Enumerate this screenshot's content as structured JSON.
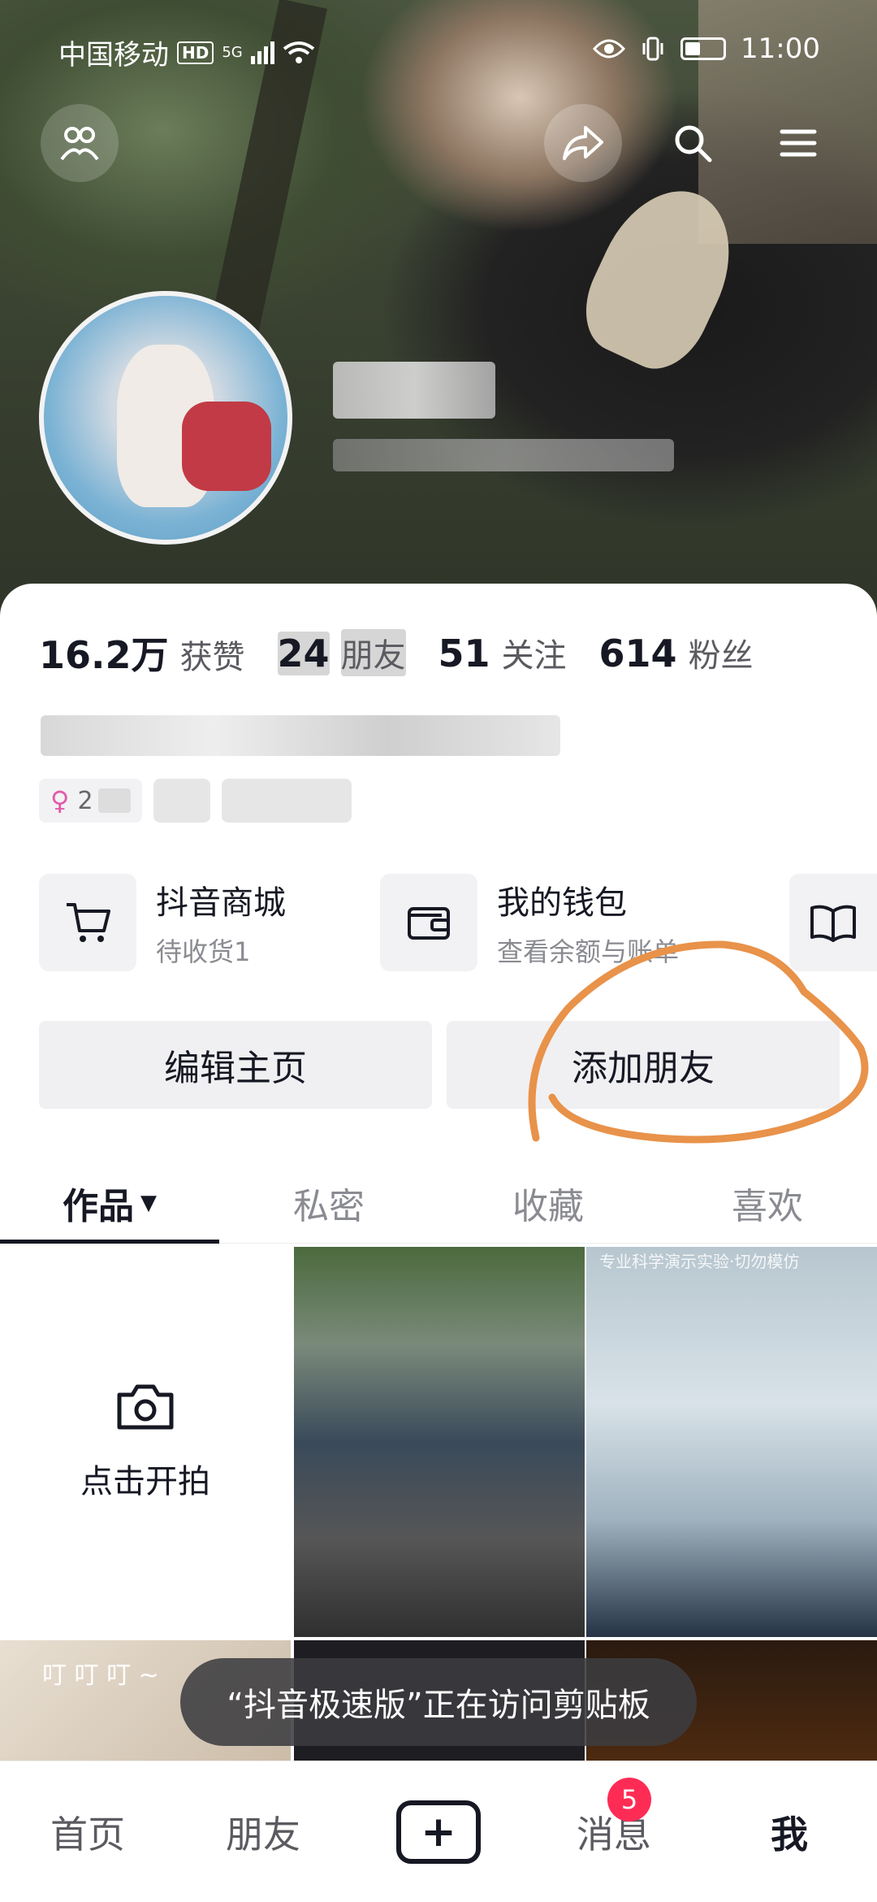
{
  "status_bar": {
    "carrier": "中国移动",
    "hd": "HD",
    "network": "5G",
    "time": "11:00"
  },
  "profile": {
    "stats": [
      {
        "value": "16.2万",
        "label": "获赞"
      },
      {
        "value": "24",
        "label": "朋友"
      },
      {
        "value": "51",
        "label": "关注"
      },
      {
        "value": "614",
        "label": "粉丝"
      }
    ],
    "tag_age": "2"
  },
  "shortcuts": [
    {
      "title": "抖音商城",
      "subtitle": "待收货1",
      "icon": "cart-icon"
    },
    {
      "title": "我的钱包",
      "subtitle": "查看余额与账单",
      "icon": "wallet-icon"
    },
    {
      "title": "",
      "subtitle": "",
      "icon": "book-icon"
    }
  ],
  "actions": {
    "edit_profile": "编辑主页",
    "add_friend": "添加朋友"
  },
  "tabs": [
    "作品",
    "私密",
    "收藏",
    "喜欢"
  ],
  "grid": {
    "shoot_label": "点击开拍",
    "video2_watermark": "专业科学演示实验·切勿模仿",
    "video3_caption": "叮 叮 叮 ~"
  },
  "toast": "“抖音极速版”正在访问剪贴板",
  "bottom_nav": {
    "home": "首页",
    "friends": "朋友",
    "messages": "消息",
    "messages_badge": "5",
    "me": "我"
  },
  "colors": {
    "accent": "#fe2c55",
    "annotation": "#e8924a",
    "text_primary": "#161823",
    "text_secondary": "#8a8b91"
  }
}
